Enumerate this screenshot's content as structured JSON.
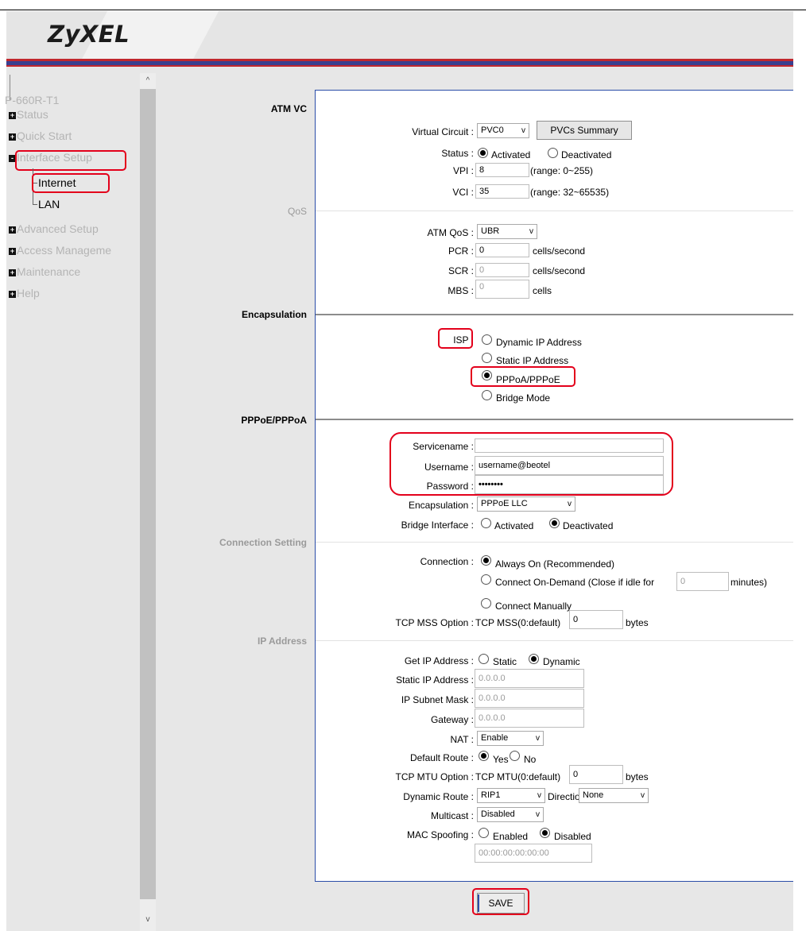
{
  "header": {
    "logo": "ZyXEL"
  },
  "sidebar": {
    "model": "P-660R-T1",
    "items": [
      {
        "label": "Status"
      },
      {
        "label": "Quick Start"
      },
      {
        "label": "Interface Setup"
      },
      {
        "label": "Advanced Setup"
      },
      {
        "label": "Access Manageme"
      },
      {
        "label": "Maintenance"
      },
      {
        "label": "Help"
      }
    ],
    "subitems": [
      {
        "label": "Internet"
      },
      {
        "label": "LAN"
      }
    ],
    "scroll_up": "^",
    "scroll_down": "v"
  },
  "sections": {
    "atm_vc": "ATM VC",
    "qos": "QoS",
    "encapsulation": "Encapsulation",
    "pppoe": "PPPoE/PPPoA",
    "connection": "Connection Setting",
    "ip": "IP Address"
  },
  "atm": {
    "vc_label": "Virtual Circuit :",
    "vc_value": "PVC0",
    "summary_button": "PVCs Summary",
    "status_label": "Status :",
    "status_opts": [
      "Activated",
      "Deactivated"
    ],
    "status_selected": "Activated",
    "vpi_label": "VPI :",
    "vpi_value": "8",
    "vpi_range": "(range: 0~255)",
    "vci_label": "VCI :",
    "vci_value": "35",
    "vci_range": "(range: 32~65535)"
  },
  "qos": {
    "atm_qos_label": "ATM QoS :",
    "atm_qos_value": "UBR",
    "pcr_label": "PCR :",
    "pcr_value": "0",
    "pcr_unit": "cells/second",
    "scr_label": "SCR :",
    "scr_value": "0",
    "scr_unit": "cells/second",
    "mbs_label": "MBS :",
    "mbs_value": "0",
    "mbs_unit": "cells"
  },
  "encap": {
    "isp_label": "ISP :",
    "options": [
      "Dynamic IP Address",
      "Static IP Address",
      "PPPoA/PPPoE",
      "Bridge Mode"
    ],
    "selected": "PPPoA/PPPoE"
  },
  "pppoe": {
    "servicename_label": "Servicename :",
    "servicename_value": "",
    "username_label": "Username :",
    "username_value": "username@beotel",
    "password_label": "Password :",
    "password_value": "••••••••",
    "encap_label": "Encapsulation :",
    "encap_value": "PPPoE LLC",
    "bridge_label": "Bridge Interface :",
    "bridge_opts": [
      "Activated",
      "Deactivated"
    ],
    "bridge_selected": "Deactivated"
  },
  "connection": {
    "label": "Connection :",
    "opt_always": "Always On (Recommended)",
    "opt_demand": "Connect On-Demand (Close if idle for",
    "idle_value": "0",
    "idle_unit": "minutes)",
    "opt_manual": "Connect Manually",
    "selected": "Always On (Recommended)",
    "mss_label": "TCP MSS Option :",
    "mss_prefix": "TCP MSS(0:default)",
    "mss_value": "0",
    "mss_unit": "bytes"
  },
  "ip": {
    "get_label": "Get IP Address :",
    "get_opts": [
      "Static",
      "Dynamic"
    ],
    "get_selected": "Dynamic",
    "static_label": "Static IP Address :",
    "static_value": "0.0.0.0",
    "mask_label": "IP Subnet Mask :",
    "mask_value": "0.0.0.0",
    "gw_label": "Gateway :",
    "gw_value": "0.0.0.0",
    "nat_label": "NAT :",
    "nat_value": "Enable",
    "default_route_label": "Default Route :",
    "default_route_opts": [
      "Yes",
      "No"
    ],
    "default_route_selected": "Yes",
    "mtu_label": "TCP MTU Option :",
    "mtu_prefix": "TCP MTU(0:default)",
    "mtu_value": "0",
    "mtu_unit": "bytes",
    "dyn_route_label": "Dynamic Route :",
    "dyn_route_value": "RIP1",
    "direction_label": "Direction",
    "direction_value": "None",
    "multicast_label": "Multicast :",
    "multicast_value": "Disabled",
    "mac_label": "MAC Spoofing :",
    "mac_opts": [
      "Enabled",
      "Disabled"
    ],
    "mac_selected": "Disabled",
    "mac_value": "00:00:00:00:00:00"
  },
  "save_button": "SAVE",
  "colors": {
    "highlight": "#e3001b",
    "brand_red": "#c1272d",
    "brand_blue": "#3a3f8f",
    "panel_border": "#2b4da8"
  }
}
